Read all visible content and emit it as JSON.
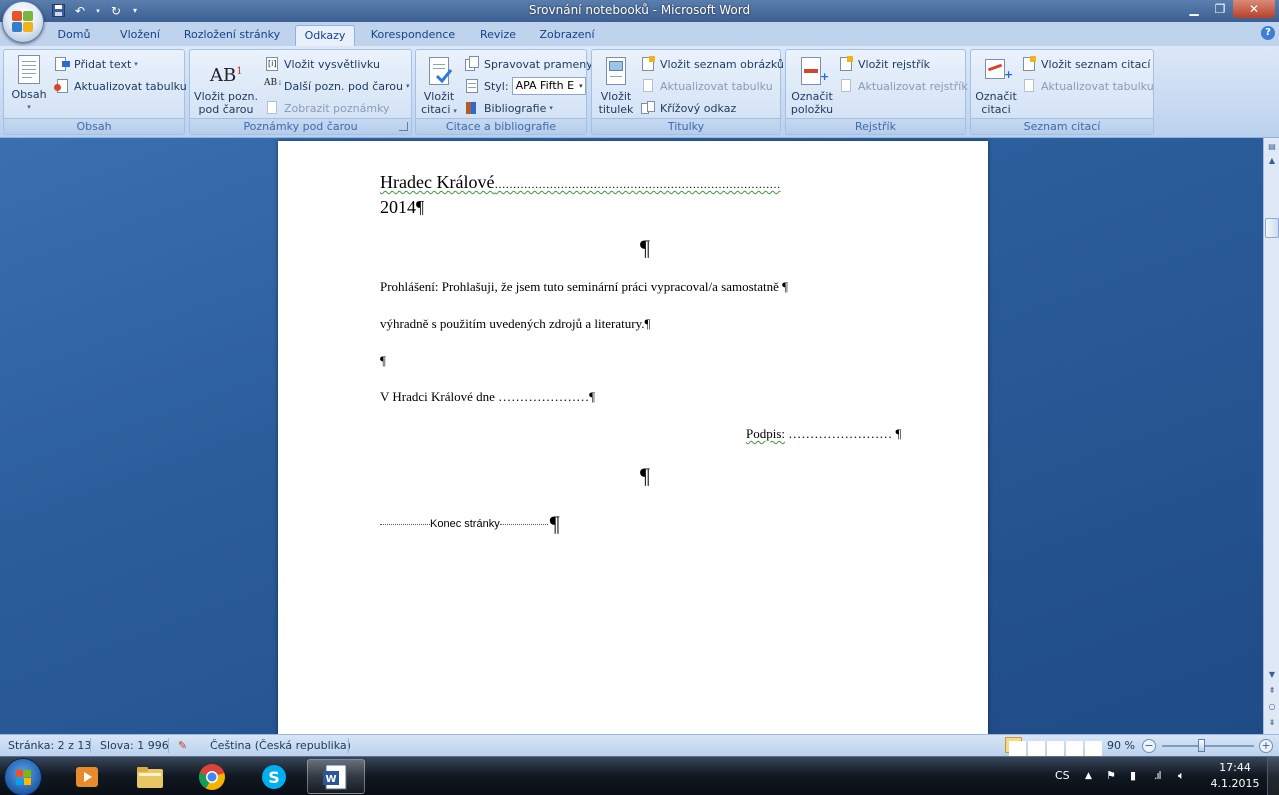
{
  "window": {
    "title": "Srovnání notebooků - Microsoft Word"
  },
  "tabs": [
    {
      "label": "Domů"
    },
    {
      "label": "Vložení"
    },
    {
      "label": "Rozložení stránky"
    },
    {
      "label": "Odkazy",
      "active": true
    },
    {
      "label": "Korespondence"
    },
    {
      "label": "Revize"
    },
    {
      "label": "Zobrazení"
    }
  ],
  "ribbon": {
    "obsah": {
      "label": "Obsah",
      "obsah_btn": "Obsah",
      "pridat_text": "Přidat text",
      "aktualizovat_tabulku": "Aktualizovat tabulku"
    },
    "poznamky": {
      "label": "Poznámky pod čarou",
      "vlozit_pozn_1": "Vložit pozn.",
      "vlozit_pozn_2": "pod čarou",
      "vlozit_vysvetlivku": "Vložit vysvětlivku",
      "dalsi_pozn": "Další pozn. pod čarou",
      "zobrazit_poznamky": "Zobrazit poznámky"
    },
    "citace": {
      "label": "Citace a bibliografie",
      "vlozit_1": "Vložit",
      "vlozit_2": "citaci",
      "spravovat_prameny": "Spravovat prameny",
      "styl_label": "Styl:",
      "styl_value": "APA Fifth E",
      "bibliografie": "Bibliografie"
    },
    "titulky": {
      "label": "Titulky",
      "vlozit_1": "Vložit",
      "vlozit_2": "titulek",
      "vlozit_seznam_obrazku": "Vložit seznam obrázků",
      "aktualizovat_tabulku": "Aktualizovat tabulku",
      "krizovy_odkaz": "Křížový odkaz"
    },
    "rejstrik": {
      "label": "Rejstřík",
      "oznacit_1": "Označit",
      "oznacit_2": "položku",
      "vlozit_rejstrik": "Vložit rejstřík",
      "aktualizovat_rejstrik": "Aktualizovat rejstřík"
    },
    "seznam_citaci": {
      "label": "Seznam citací",
      "oznacit_1": "Označit",
      "oznacit_2": "citaci",
      "vlozit_seznam_citaci": "Vložit seznam citací",
      "aktualizovat_tabulku": "Aktualizovat tabulku"
    }
  },
  "document": {
    "city": "Hradec Králové",
    "city_dots": "……………………………………………………………………",
    "year": "2014¶",
    "pilcrow": "¶",
    "prohlaseni_1": "Prohlášení: Prohlašuji, že jsem tuto seminární práci vypracoval/a samostatně ¶",
    "prohlaseni_2": "výhradně s použitím uvedených zdrojů a literatury.¶",
    "empty_para": "¶",
    "v_hradci": "V Hradci Králové dne  …………………¶",
    "podpis_label": "Podpis:",
    "podpis_dots": " …………………… ¶",
    "page_break": "Konec stránky"
  },
  "status": {
    "page": "Stránka: 2 z 13",
    "words": "Slova: 1 996",
    "language": "Čeština (Česká republika)",
    "zoom": "90 %"
  },
  "taskbar": {
    "language": "CS",
    "time": "17:44",
    "date": "4.1.2015"
  },
  "colors": {
    "ribbon_bg": "#c6d9f1",
    "accent": "#15428b",
    "doc_bg": "#2b5d9b"
  }
}
